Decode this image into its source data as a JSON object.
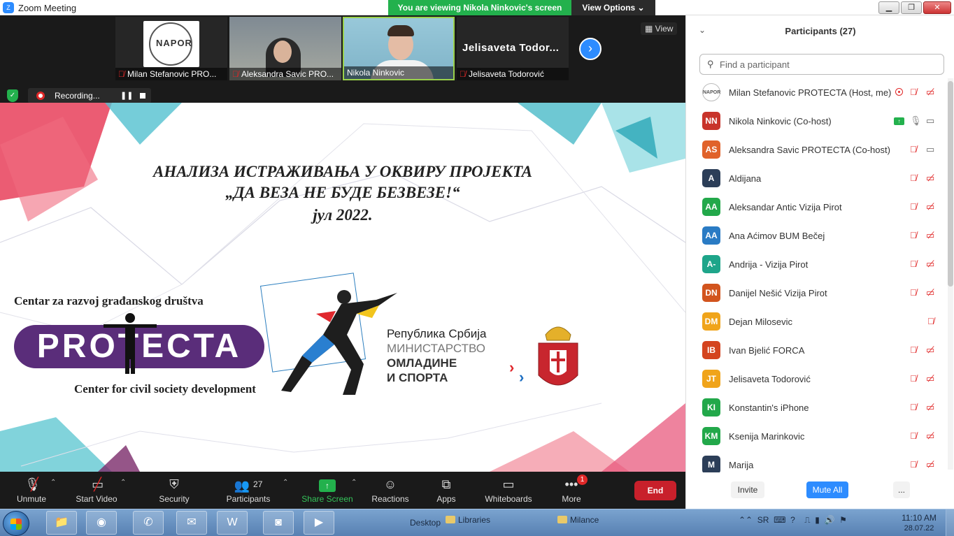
{
  "app": {
    "title": "Zoom Meeting",
    "logo_text": "Z",
    "viewing_banner": "You are viewing Nikola Ninkovic's screen",
    "view_options": "View Options ⌄",
    "window_controls": [
      "▁",
      "❐",
      "✕"
    ]
  },
  "video_strip": {
    "tiles": [
      {
        "name": "Milan Stefanovic PRO...",
        "muted": true,
        "logo_word": "NAPOR"
      },
      {
        "name": "Aleksandra Savic PRO...",
        "muted": true
      },
      {
        "name": "Nikola Ninkovic",
        "muted": false,
        "active": true
      },
      {
        "name": "Jelisaveta Todorović",
        "muted": true,
        "display_name": "Jelisaveta Todor..."
      }
    ],
    "next_glyph": "›",
    "view_label": "View",
    "recording": {
      "label": "Recording...",
      "pause_glyph": "❚❚"
    }
  },
  "slide": {
    "title_lines": [
      "АНАЛИЗА ИСТРАЖИВАЊА У ОКВИРУ ПРОЈЕКТА",
      "„ДА ВЕЗА НЕ БУДЕ БЕЗВЕЗЕ!“",
      "јул 2022."
    ],
    "org_top": "Centar za razvoj građanskog društva",
    "org_logo": "PROTECTA",
    "org_bottom": "Center for civil society development",
    "ministry_lines": [
      "Република Србија",
      "МИНИСТАРСТВО",
      "ОМЛАДИНЕ",
      "И СПОРТА"
    ]
  },
  "toolbar": {
    "unmute": "Unmute",
    "start_video": "Start Video",
    "security": "Security",
    "participants": "Participants",
    "participants_count": "27",
    "share_screen": "Share Screen",
    "reactions": "Reactions",
    "apps": "Apps",
    "whiteboards": "Whiteboards",
    "more": "More",
    "more_badge": "1",
    "end": "End"
  },
  "participants_panel": {
    "title": "Participants (27)",
    "search_placeholder": "Find a participant",
    "participants": [
      {
        "initials": "",
        "name": "Milan Stefanovic PROTECTA (Host, me)",
        "color": "#ffffff",
        "mic": "muted",
        "video": "off",
        "recording": true
      },
      {
        "initials": "NN",
        "name": "Nikola Ninkovic (Co-host)",
        "color": "#c8342b",
        "mic": "on",
        "video": "on",
        "sharing": true
      },
      {
        "initials": "AS",
        "name": "Aleksandra Savic PROTECTA (Co-host)",
        "color": "#e0622a",
        "mic": "muted",
        "video": "on"
      },
      {
        "initials": "A",
        "name": "Aldijana",
        "color": "#2c3e58",
        "mic": "muted",
        "video": "off"
      },
      {
        "initials": "AA",
        "name": "Aleksandar Antic Vizija Pirot",
        "color": "#22a84a",
        "mic": "muted",
        "video": "off"
      },
      {
        "initials": "AA",
        "name": "Ana Aćimov BUM Bečej",
        "color": "#2a7bc4",
        "mic": "muted",
        "video": "off"
      },
      {
        "initials": "A-",
        "name": "Andrija - Vizija Pirot",
        "color": "#1ea58a",
        "mic": "muted",
        "video": "off"
      },
      {
        "initials": "DN",
        "name": "Danijel Nešić Vizija Pirot",
        "color": "#d2541e",
        "mic": "muted",
        "video": "off"
      },
      {
        "initials": "DM",
        "name": "Dejan Milosevic",
        "color": "#f0a41a",
        "mic": "muted",
        "video": "none"
      },
      {
        "initials": "IB",
        "name": "Ivan Bjelić FORCA",
        "color": "#d4441f",
        "mic": "muted",
        "video": "off"
      },
      {
        "initials": "JT",
        "name": "Jelisaveta Todorović",
        "color": "#f0a41a",
        "mic": "muted",
        "video": "off"
      },
      {
        "initials": "KI",
        "name": "Konstantin's iPhone",
        "color": "#22a84a",
        "mic": "muted",
        "video": "off"
      },
      {
        "initials": "KM",
        "name": "Ksenija Marinkovic",
        "color": "#22a84a",
        "mic": "muted",
        "video": "off"
      },
      {
        "initials": "M",
        "name": "Marija",
        "color": "#2c3e58",
        "mic": "muted",
        "video": "off"
      }
    ],
    "avatar_image_text": "NAPOR",
    "invite": "Invite",
    "mute_all": "Mute All",
    "more": "..."
  },
  "taskbar": {
    "desktop_label": "Desktop",
    "libraries_label": "Libraries",
    "milance_label": "Milance",
    "language": "SR",
    "time": "11:10 AM",
    "date": "28.07.22"
  }
}
